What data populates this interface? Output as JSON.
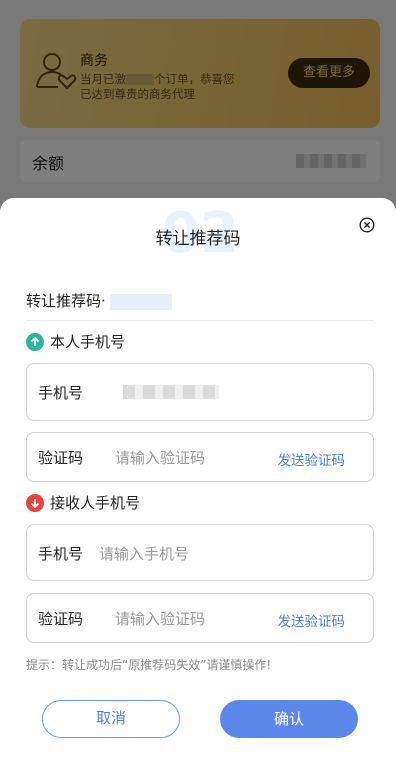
{
  "background": {
    "business_card": {
      "title": "商务",
      "desc_part1": "当月已激",
      "desc_part2": "个订单，恭喜您",
      "desc_line2": "已达到尊贵的商务代理",
      "more_button": "查看更多"
    },
    "balance_label": "余额"
  },
  "dialog": {
    "watermark": "02",
    "title": "转让推荐码",
    "code_label": "转让推荐码·",
    "own_section": {
      "title": "本人手机号",
      "phone_label": "手机号",
      "code_label": "验证码",
      "code_placeholder": "请输入验证码",
      "send_code": "发送验证码"
    },
    "receiver_section": {
      "title": "接收人手机号",
      "phone_label": "手机号",
      "phone_placeholder": "请输入手机号",
      "code_label": "验证码",
      "code_placeholder": "请输入验证码",
      "send_code": "发送验证码"
    },
    "tip": "提示：转让成功后“原推荐码失效”请谨慎操作!",
    "cancel_button": "取消",
    "confirm_button": "确认"
  },
  "icons": {
    "close": "close-circle-icon",
    "up": "arrow-up-icon",
    "down": "arrow-down-icon",
    "business": "user-heart-icon"
  },
  "colors": {
    "accent": "#5b87ea",
    "up_dot": "#2db59a",
    "down_dot": "#e8433c",
    "gold": "#f1c867"
  }
}
